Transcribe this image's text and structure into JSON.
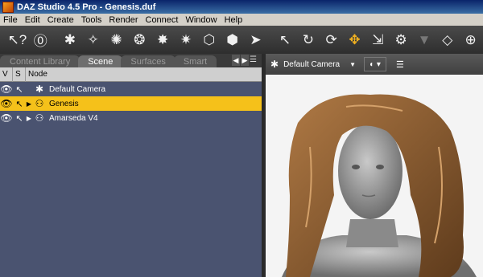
{
  "window": {
    "title": "DAZ Studio 4.5 Pro - Genesis.duf"
  },
  "menu": [
    "File",
    "Edit",
    "Create",
    "Tools",
    "Render",
    "Connect",
    "Window",
    "Help"
  ],
  "tabs": [
    "Content Library",
    "Scene",
    "Surfaces",
    "Smart"
  ],
  "scene": {
    "columns": [
      "V",
      "S",
      "Node"
    ],
    "rows": [
      {
        "label": "Default Camera",
        "selected": false
      },
      {
        "label": "Genesis",
        "selected": true
      },
      {
        "label": "Amarseda V4",
        "selected": false
      }
    ]
  },
  "viewport": {
    "camera": "Default Camera"
  },
  "colors": {
    "selection": "#f5c11a",
    "scene_bg": "#4a5370",
    "accent": "#f0b020"
  }
}
